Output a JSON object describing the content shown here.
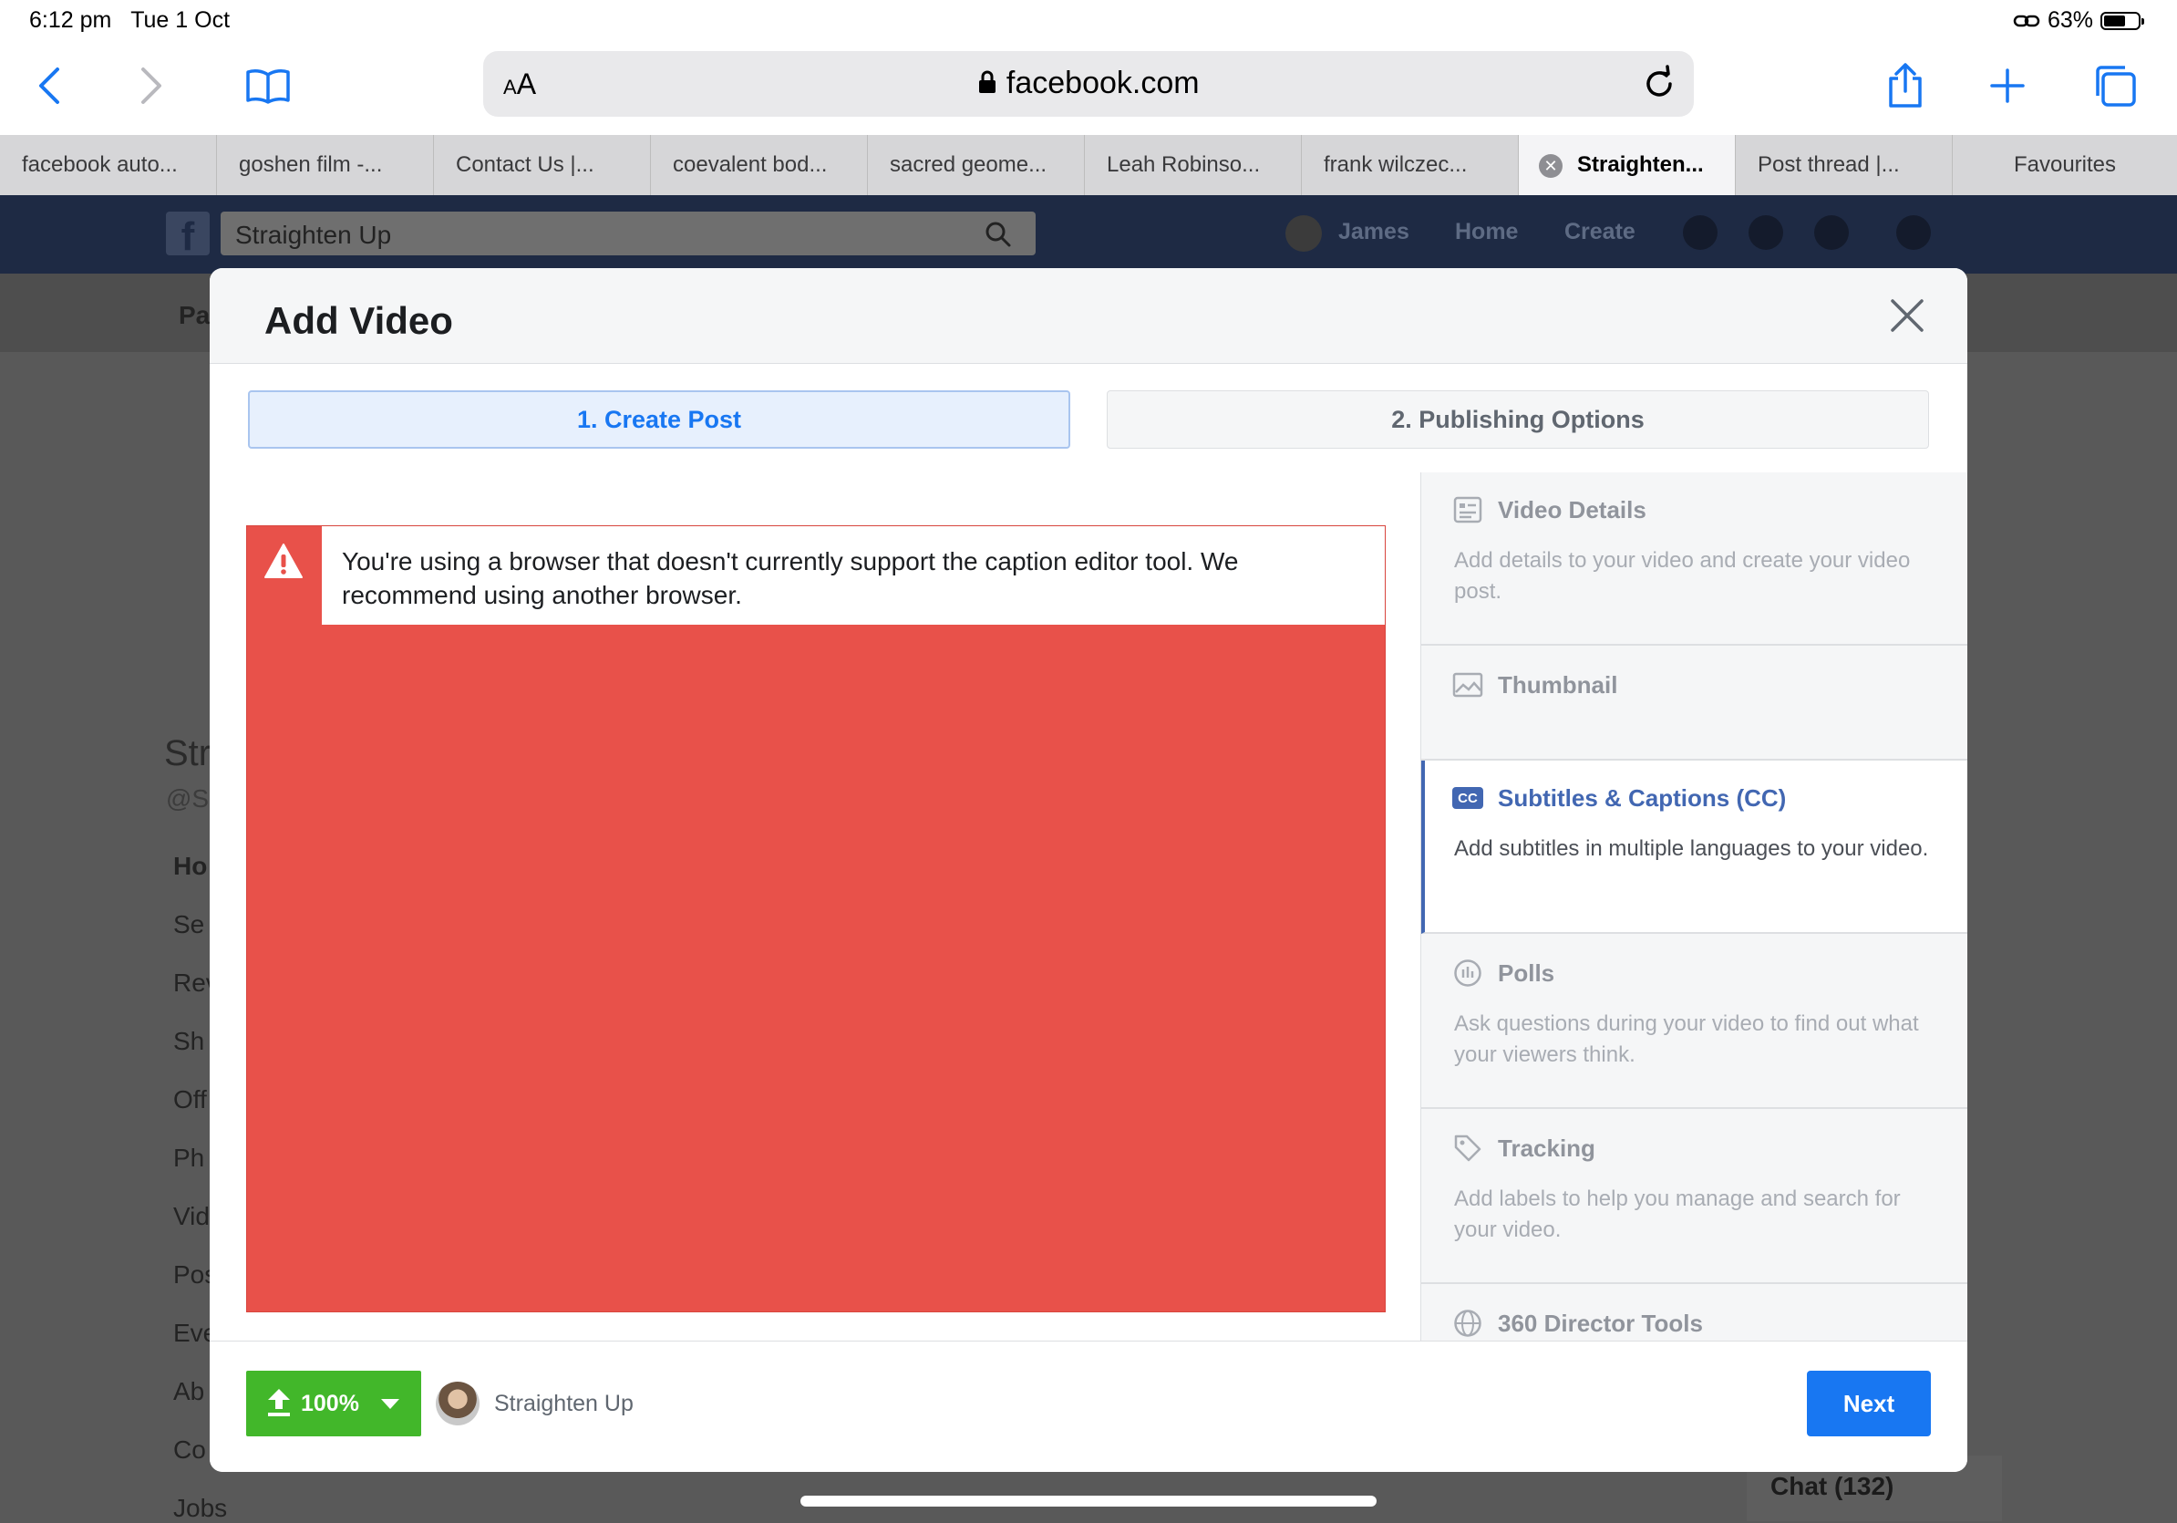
{
  "status_bar": {
    "time": "6:12 pm",
    "date": "Tue 1 Oct",
    "battery": "63%",
    "battery_level": 0.63
  },
  "browser": {
    "text_size_label": "AA",
    "url": "facebook.com",
    "tabs": [
      {
        "label": "facebook auto..."
      },
      {
        "label": "goshen film -..."
      },
      {
        "label": "Contact Us |..."
      },
      {
        "label": "coevalent bod..."
      },
      {
        "label": "sacred geome..."
      },
      {
        "label": "Leah Robinso..."
      },
      {
        "label": "frank wilczec..."
      },
      {
        "label": "Straighten...",
        "active": true
      },
      {
        "label": "Post thread |..."
      },
      {
        "label": "Favourites"
      }
    ]
  },
  "facebook": {
    "search_value": "Straighten Up",
    "nav": {
      "user": "James",
      "home": "Home",
      "create": "Create"
    },
    "background_menu": [
      "Pa",
      "Str",
      "@S",
      "Ho",
      "Se",
      "Rev",
      "Sh",
      "Off",
      "Ph",
      "Vid",
      "Pos",
      "Eve",
      "Ab",
      "Co",
      "Jobs"
    ],
    "chat_label": "Chat (132)"
  },
  "modal": {
    "title": "Add Video",
    "steps": {
      "step1": "1. Create Post",
      "step2": "2. Publishing Options"
    },
    "error_message": "You're using a browser that doesn't currently support the caption editor tool. We recommend using another browser.",
    "sidebar": [
      {
        "title": "Video Details",
        "desc": "Add details to your video and create your video post.",
        "icon": "video-details-icon"
      },
      {
        "title": "Thumbnail",
        "desc": "",
        "icon": "image-icon"
      },
      {
        "title": "Subtitles & Captions (CC)",
        "desc": "Add subtitles in multiple languages to your video.",
        "icon": "cc-icon",
        "cc_text": "CC",
        "active": true
      },
      {
        "title": "Polls",
        "desc": "Ask questions during your video to find out what your viewers think.",
        "icon": "poll-icon"
      },
      {
        "title": "Tracking",
        "desc": "Add labels to help you manage and search for your video.",
        "icon": "tag-icon"
      },
      {
        "title": "360 Director Tools",
        "desc": "",
        "icon": "globe-icon"
      }
    ],
    "footer": {
      "upload_progress": "100%",
      "upload_level": 1.0,
      "page_name": "Straighten Up",
      "next_label": "Next"
    }
  },
  "colors": {
    "accent": "#1877f2",
    "fb_blue": "#4267b2",
    "error_red": "#e8514a",
    "upload_green": "#42b72a"
  }
}
